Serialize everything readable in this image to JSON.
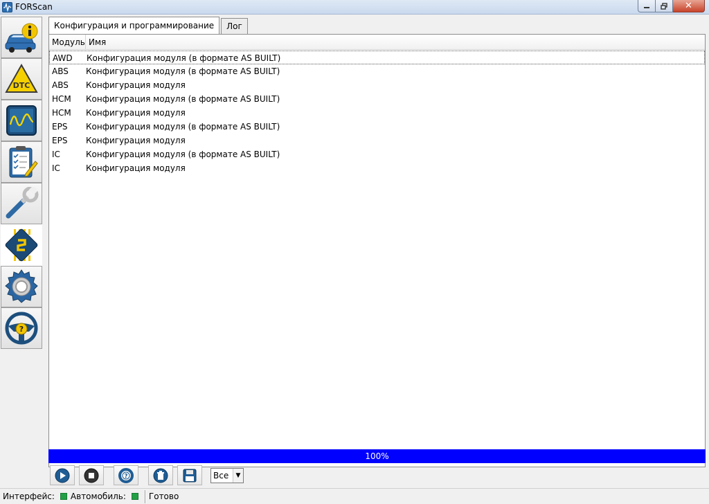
{
  "window": {
    "title": "FORScan"
  },
  "tabs": [
    {
      "label": "Конфигурация и программирование",
      "active": true
    },
    {
      "label": "Лог",
      "active": false
    }
  ],
  "table": {
    "columns": [
      "Модуль",
      "Имя"
    ],
    "rows": [
      {
        "module": "AWD",
        "name": "Конфигурация модуля (в формате AS BUILT)"
      },
      {
        "module": "ABS",
        "name": "Конфигурация модуля (в формате AS BUILT)"
      },
      {
        "module": "ABS",
        "name": "Конфигурация модуля"
      },
      {
        "module": "HCM",
        "name": "Конфигурация модуля (в формате AS BUILT)"
      },
      {
        "module": "HCM",
        "name": "Конфигурация модуля"
      },
      {
        "module": "EPS",
        "name": "Конфигурация модуля (в формате AS BUILT)"
      },
      {
        "module": "EPS",
        "name": "Конфигурация модуля"
      },
      {
        "module": "IC",
        "name": "Конфигурация модуля (в формате AS BUILT)"
      },
      {
        "module": "IC",
        "name": "Конфигурация модуля"
      }
    ]
  },
  "progress": {
    "value": 100,
    "label": "100%"
  },
  "toolbar": {
    "filter_value": "Все"
  },
  "statusbar": {
    "interface_label": "Интерфейс:",
    "vehicle_label": "Автомобиль:",
    "status_text": "Готово",
    "indicator_color": "#22a045"
  },
  "sidebar": [
    {
      "icon": "vehicle-info-icon"
    },
    {
      "icon": "dtc-icon"
    },
    {
      "icon": "oscilloscope-icon"
    },
    {
      "icon": "checklist-icon"
    },
    {
      "icon": "wrench-icon"
    },
    {
      "icon": "chip-icon",
      "active": true
    },
    {
      "icon": "settings-gear-icon"
    },
    {
      "icon": "help-steering-wheel-icon"
    }
  ]
}
